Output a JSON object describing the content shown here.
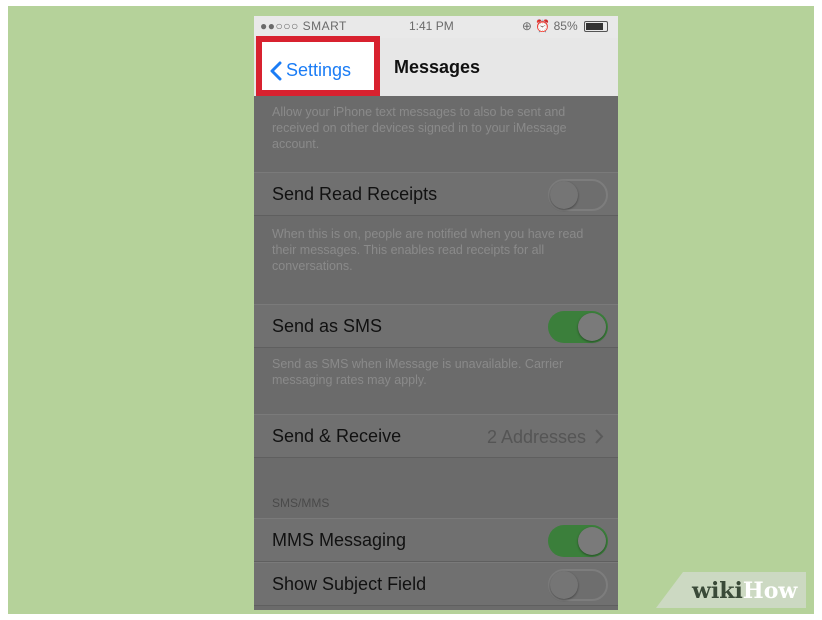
{
  "status_bar": {
    "carrier": "●●○○○ SMART",
    "time": "1:41 PM",
    "battery": "85%"
  },
  "nav": {
    "back_label": "Settings",
    "title": "Messages"
  },
  "imessage_footnote": "Allow your iPhone text messages to also be sent and received on other devices signed in to your iMessage account.",
  "rows": {
    "read_receipts": {
      "label": "Send Read Receipts",
      "on": false
    },
    "read_receipts_footnote": "When this is on, people are notified when you have read their messages. This enables read receipts for all conversations.",
    "send_as_sms": {
      "label": "Send as SMS",
      "on": true
    },
    "send_as_sms_footnote": "Send as SMS when iMessage is unavailable. Carrier messaging rates may apply.",
    "send_receive": {
      "label": "Send & Receive",
      "detail": "2 Addresses"
    },
    "sms_mms_header": "SMS/MMS",
    "mms_messaging": {
      "label": "MMS Messaging",
      "on": true
    },
    "show_subject": {
      "label": "Show Subject Field",
      "on": false
    }
  },
  "watermark": {
    "wiki": "wiki",
    "how": "How"
  },
  "colors": {
    "background": "#b5d29a",
    "highlight": "#d8212f",
    "ios_blue": "#1a7cf5",
    "switch_on": "#3b7f3b"
  }
}
